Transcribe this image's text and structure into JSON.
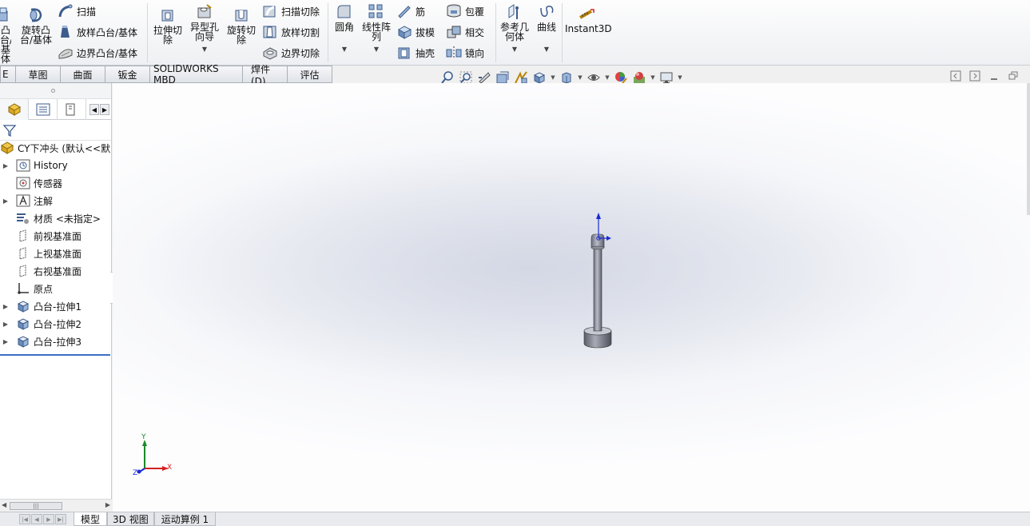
{
  "ribbon": {
    "partial_left_label": "凸台/基体",
    "revolve_boss": "旋转凸台/基体",
    "sweep": "扫描",
    "loft_boss": "放样凸台/基体",
    "boundary_boss": "边界凸台/基体",
    "extrude_cut": "拉伸切除",
    "hole_wizard": "异型孔向导",
    "revolve_cut": "旋转切除",
    "swept_cut": "扫描切除",
    "lofted_cut": "放样切割",
    "boundary_cut": "边界切除",
    "fillet": "圆角",
    "linear_pattern": "线性阵列",
    "rib": "筋",
    "draft": "拔模",
    "shell": "抽壳",
    "wrap": "包覆",
    "intersect": "相交",
    "mirror": "镜向",
    "reference_geometry": "参考几何体",
    "curves": "曲线",
    "instant3d": "Instant3D"
  },
  "tabs": [
    {
      "label": "E"
    },
    {
      "label": "草图"
    },
    {
      "label": "曲面"
    },
    {
      "label": "钣金"
    },
    {
      "label": "SOLIDWORKS MBD"
    },
    {
      "label": "焊件(D)"
    },
    {
      "label": "评估"
    }
  ],
  "tree": {
    "root": "CY下冲头 (默认<<默",
    "history": "History",
    "sensors": "传感器",
    "annotations": "注解",
    "material": "材质 <未指定>",
    "front_plane": "前视基准面",
    "top_plane": "上视基准面",
    "right_plane": "右视基准面",
    "origin": "原点",
    "boss1": "凸台-拉伸1",
    "boss2": "凸台-拉伸2",
    "boss3": "凸台-拉伸3"
  },
  "triad": {
    "x": "X",
    "y": "Y",
    "z": "Z"
  },
  "bottom_tabs": [
    {
      "label": "模型"
    },
    {
      "label": "3D 视图"
    },
    {
      "label": "运动算例 1"
    }
  ],
  "colors": {
    "accent": "#3a6fc4",
    "axis_x": "#d42020",
    "axis_y": "#1a8a2a",
    "axis_z": "#1a2ad4"
  }
}
